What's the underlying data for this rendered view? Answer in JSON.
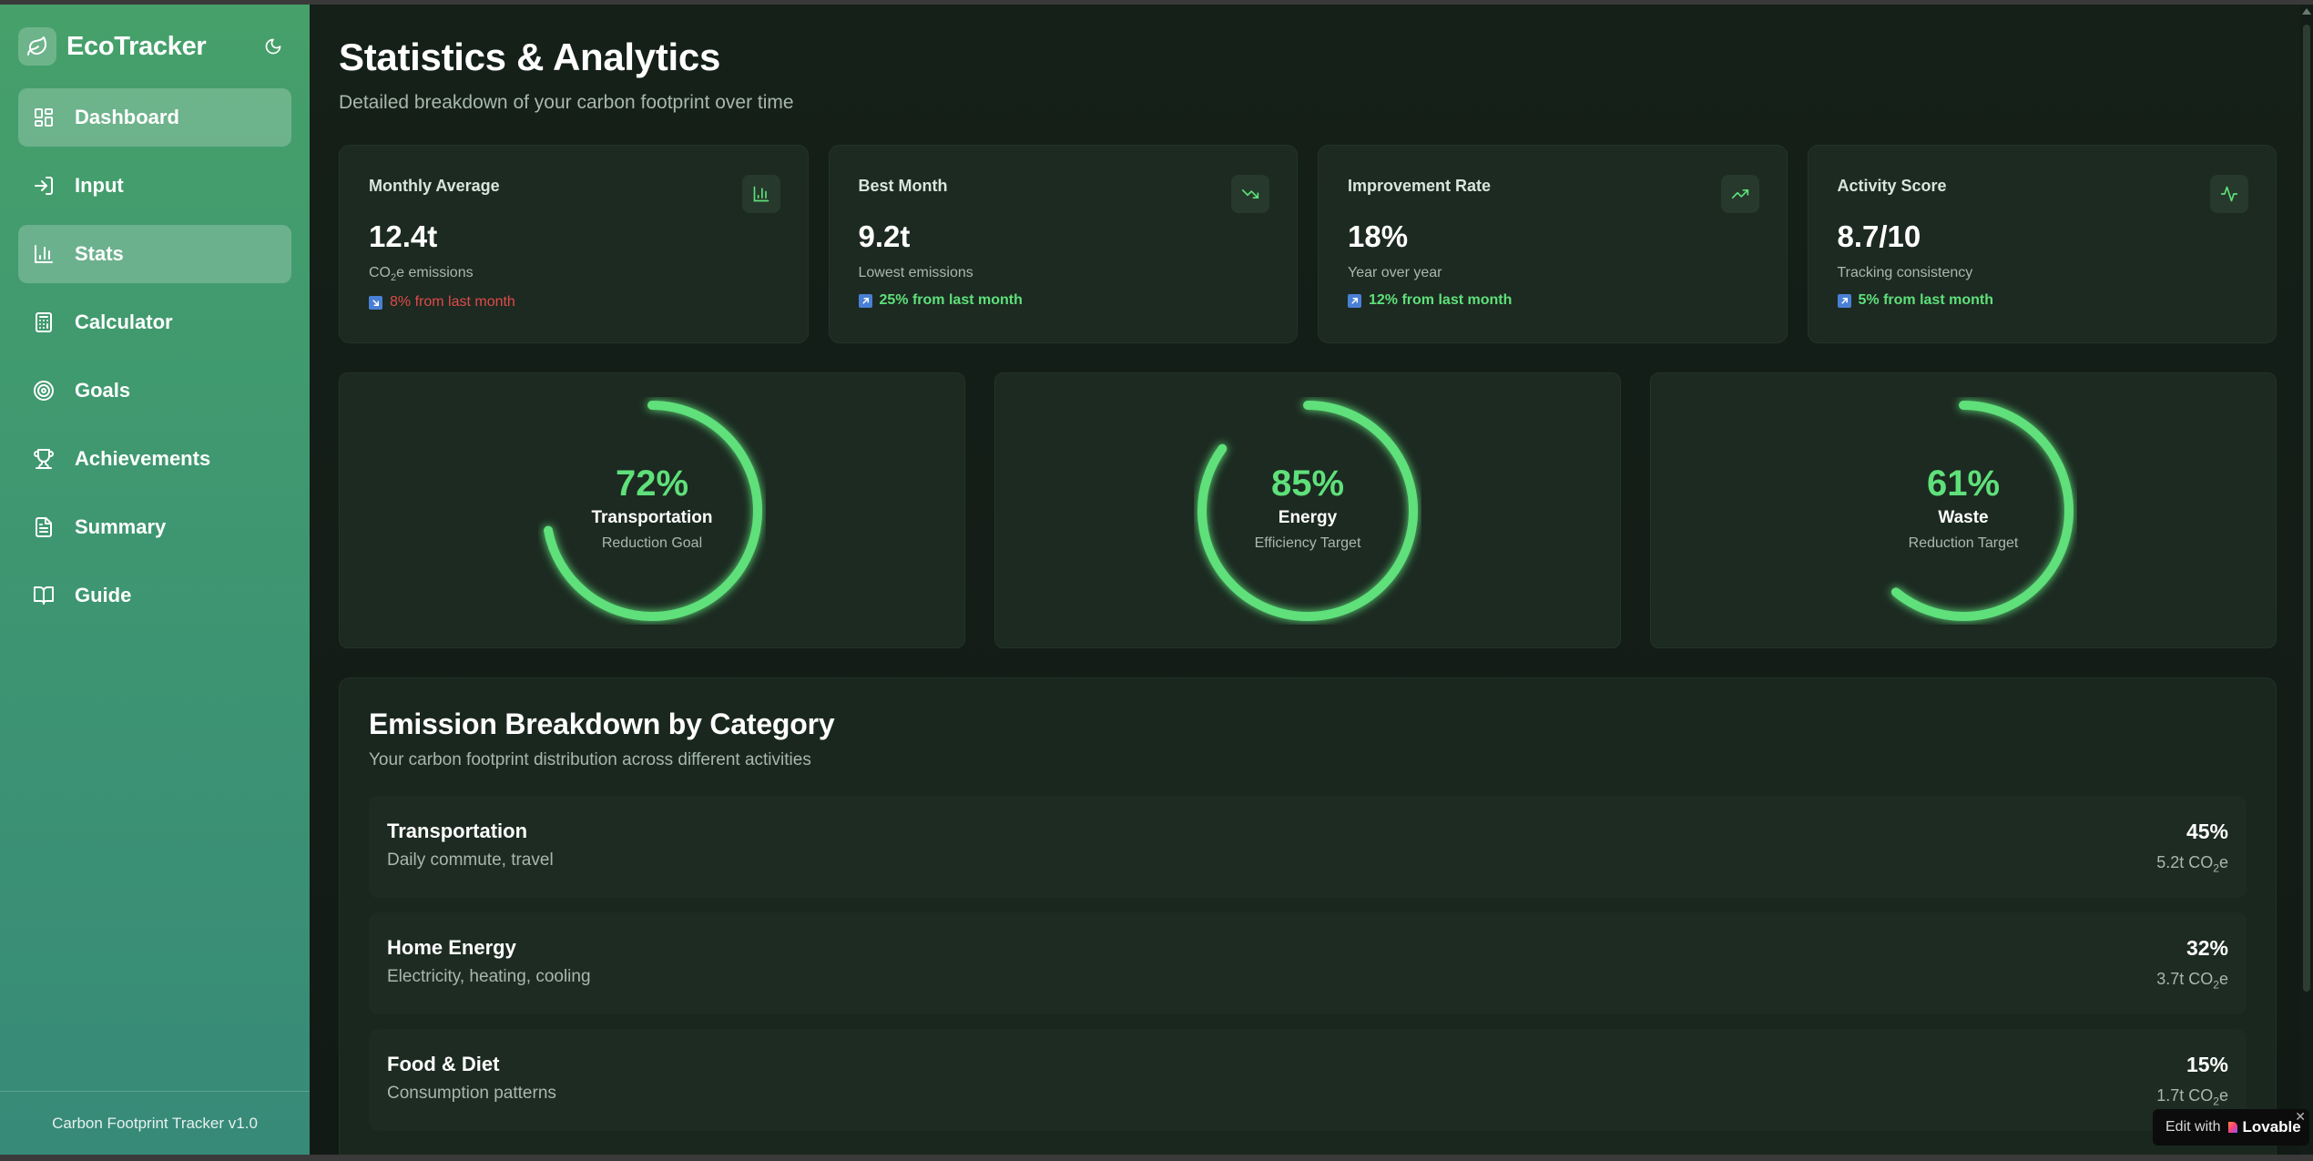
{
  "brand": {
    "name": "EcoTracker"
  },
  "sidebar": {
    "items": [
      {
        "label": "Dashboard",
        "icon": "dashboard-icon",
        "active": true
      },
      {
        "label": "Input",
        "icon": "input-icon",
        "active": false
      },
      {
        "label": "Stats",
        "icon": "bar-chart-icon",
        "active": true
      },
      {
        "label": "Calculator",
        "icon": "calculator-icon",
        "active": false
      },
      {
        "label": "Goals",
        "icon": "target-icon",
        "active": false
      },
      {
        "label": "Achievements",
        "icon": "trophy-icon",
        "active": false
      },
      {
        "label": "Summary",
        "icon": "file-text-icon",
        "active": false
      },
      {
        "label": "Guide",
        "icon": "book-icon",
        "active": false
      }
    ],
    "footer": "Carbon Footprint Tracker v1.0"
  },
  "header": {
    "title": "Statistics & Analytics",
    "subtitle": "Detailed breakdown of your carbon footprint over time"
  },
  "stats": [
    {
      "title": "Monthly Average",
      "value": "12.4t",
      "desc_prefix": "CO",
      "desc_sub": "2",
      "desc_suffix": "e emissions",
      "change": "8% from last month",
      "trend": "negative",
      "icon": "bar-chart-icon"
    },
    {
      "title": "Best Month",
      "value": "9.2t",
      "desc": "Lowest emissions",
      "change": "25% from last month",
      "trend": "positive",
      "icon": "trending-down-icon"
    },
    {
      "title": "Improvement Rate",
      "value": "18%",
      "desc": "Year over year",
      "change": "12% from last month",
      "trend": "positive",
      "icon": "trending-up-icon"
    },
    {
      "title": "Activity Score",
      "value": "8.7/10",
      "desc": "Tracking consistency",
      "change": "5% from last month",
      "trend": "positive",
      "icon": "activity-icon"
    }
  ],
  "rings": [
    {
      "percent": 72,
      "percent_label": "72%",
      "label": "Transportation",
      "sub": "Reduction Goal"
    },
    {
      "percent": 85,
      "percent_label": "85%",
      "label": "Energy",
      "sub": "Efficiency Target"
    },
    {
      "percent": 61,
      "percent_label": "61%",
      "label": "Waste",
      "sub": "Reduction Target"
    }
  ],
  "breakdown": {
    "title": "Emission Breakdown by Category",
    "subtitle": "Your carbon footprint distribution across different activities",
    "items": [
      {
        "name": "Transportation",
        "detail": "Daily commute, travel",
        "pct": "45%",
        "amount": "5.2t CO",
        "amount_sub": "2",
        "amount_suffix": "e"
      },
      {
        "name": "Home Energy",
        "detail": "Electricity, heating, cooling",
        "pct": "32%",
        "amount": "3.7t CO",
        "amount_sub": "2",
        "amount_suffix": "e"
      },
      {
        "name": "Food & Diet",
        "detail": "Consumption patterns",
        "pct": "15%",
        "amount": "1.7t CO",
        "amount_sub": "2",
        "amount_suffix": "e"
      }
    ]
  },
  "badge": {
    "edit": "Edit with",
    "brand": "Lovable",
    "close": "✕"
  },
  "colors": {
    "accent": "#5fe07a",
    "negative": "#e04a4a",
    "sidebar_top": "#46a06a",
    "sidebar_bottom": "#378a78",
    "background": "#121a15",
    "card": "#1c2a21"
  }
}
